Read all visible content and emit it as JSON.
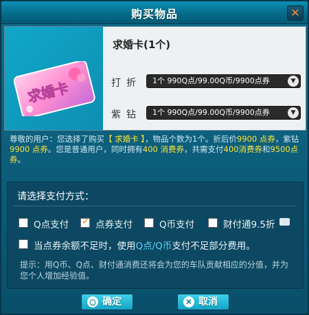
{
  "window": {
    "title": "购买物品",
    "close_symbol": "✕"
  },
  "item": {
    "name": "求婚卡(1个)",
    "card_text": "求婚卡",
    "options": [
      {
        "label": "打折",
        "value": "1个  990Q点/99.00Q币/9900点券"
      },
      {
        "label": "紫钻",
        "value": "1个  990Q点/99.00Q币/9900点券"
      }
    ]
  },
  "info": {
    "p1": "尊敬的用户：您选择了购买",
    "item_bracket": "【 求婚卡 】",
    "p2": "，物品个数为1个。折后价",
    "price1": "9900 点券",
    "p3": "，紫钻",
    "price2": "9900 点券",
    "p4": "。您是普通用户，同时拥有",
    "have": "400 消费券",
    "p5": "，共需支付",
    "need1": "400消费券",
    "p6": "和",
    "need2": "9500点券",
    "p7": "。"
  },
  "payment": {
    "heading": "请选择支付方式：",
    "methods": [
      {
        "label": "Q点支付",
        "checked": false
      },
      {
        "label": "点券支付",
        "checked": true
      },
      {
        "label": "Q币支付",
        "checked": false
      },
      {
        "label": "财付通9.5折",
        "checked": false
      }
    ],
    "fallback_p1": "当点券余额不足时，使用",
    "fallback_blue": "Q点/Q币",
    "fallback_p2": "支付不足部分费用。",
    "hint": "提示：用Q币、Q点、财付通消费还将会为您的车队贡献相应的分值，并为您个人增加经验值。"
  },
  "buttons": {
    "ok": "确定",
    "cancel": "取消"
  },
  "colors": {
    "accent": "#14a5c8",
    "highlight": "#ffe23a",
    "check": "#ff7a00"
  }
}
